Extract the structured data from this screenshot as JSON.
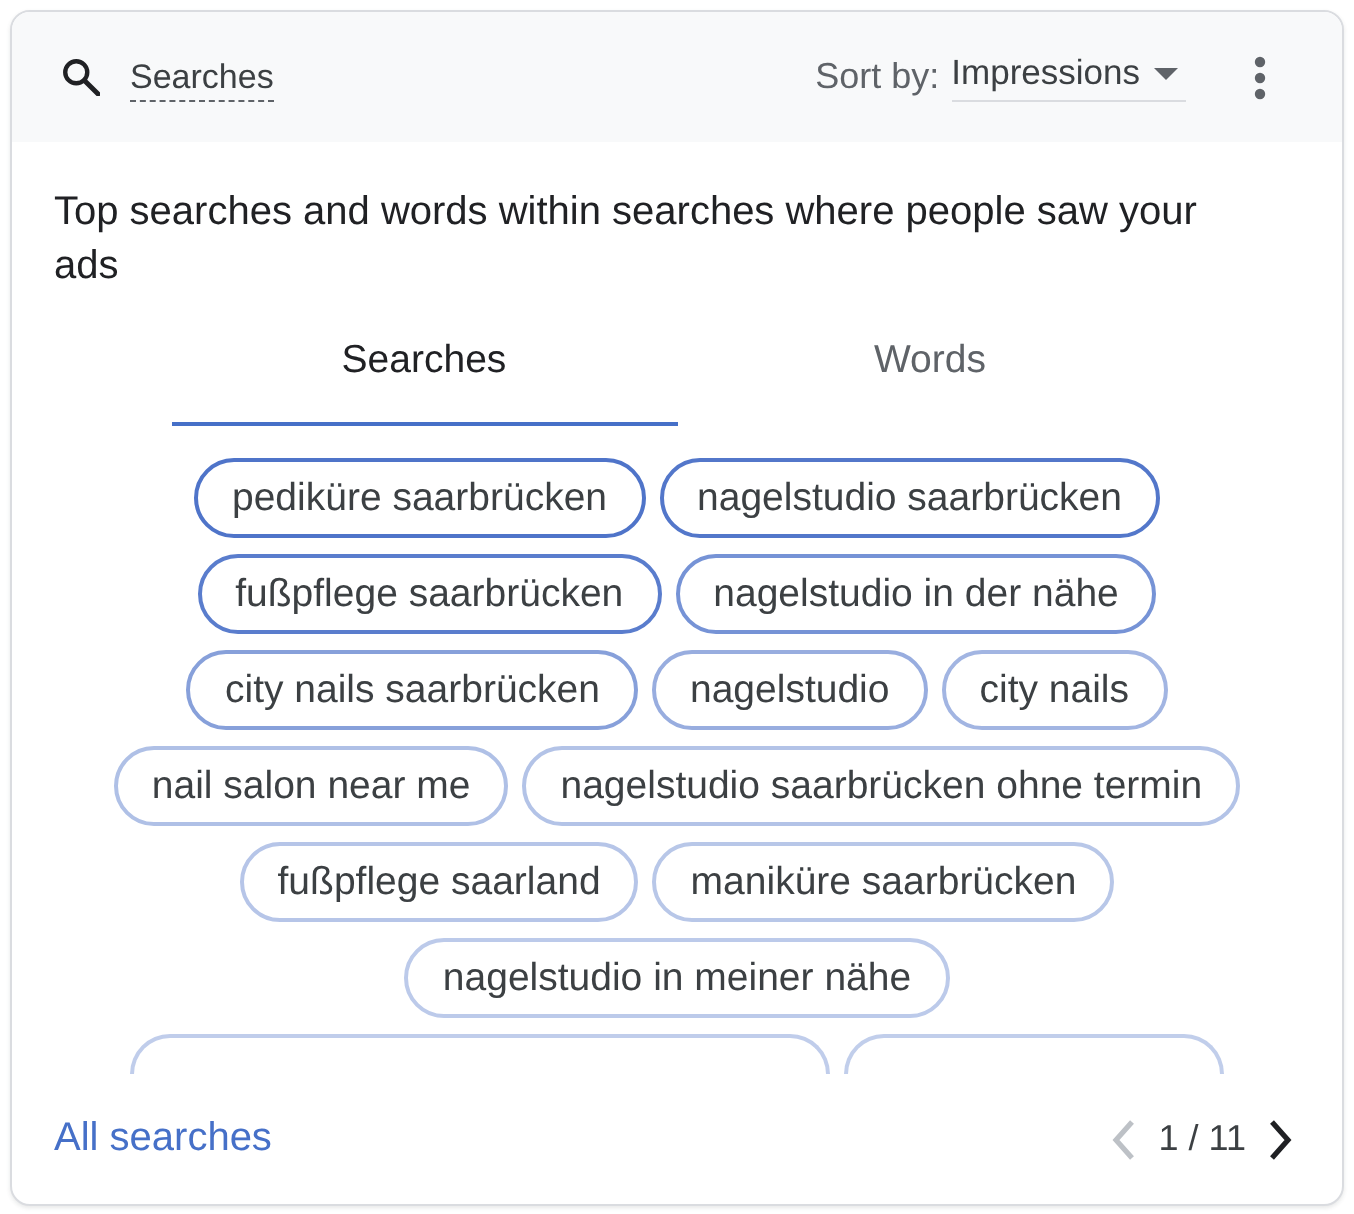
{
  "header": {
    "title": "Searches",
    "sort_label": "Sort by:",
    "sort_value": "Impressions"
  },
  "description": "Top searches and words within searches where people saw your ads",
  "tabs": [
    {
      "label": "Searches",
      "selected": true
    },
    {
      "label": "Words",
      "selected": false
    }
  ],
  "chip_rows": [
    [
      {
        "kind": "term",
        "label": "pediküre saarbrücken",
        "color": "#4f74c9"
      },
      {
        "kind": "term",
        "label": "nagelstudio saarbrücken",
        "color": "#5377ca"
      }
    ],
    [
      {
        "kind": "term",
        "label": "fußpflege saarbrücken",
        "color": "#5a7dcd"
      },
      {
        "kind": "term",
        "label": "nagelstudio in der nähe",
        "color": "#7693d6"
      }
    ],
    [
      {
        "kind": "term",
        "label": "city nails saarbrücken",
        "color": "#87a0da"
      },
      {
        "kind": "term",
        "label": "nagelstudio",
        "color": "#98addf"
      },
      {
        "kind": "term",
        "label": "city nails",
        "color": "#a2b5e2"
      }
    ],
    [
      {
        "kind": "term",
        "label": "nail salon near me",
        "color": "#afc0e6"
      },
      {
        "kind": "term",
        "label": "nagelstudio saarbrücken ohne termin",
        "color": "#b3c3e7"
      }
    ],
    [
      {
        "kind": "term",
        "label": "fußpflege saarland",
        "color": "#b6c5e8"
      },
      {
        "kind": "term",
        "label": "maniküre saarbrücken",
        "color": "#b8c7e8"
      }
    ],
    [
      {
        "kind": "term",
        "label": "nagelstudio in meiner nähe",
        "color": "#bccaea"
      }
    ],
    [
      {
        "kind": "cut",
        "color": "#c0cdeb"
      },
      {
        "kind": "cut",
        "color": "#c1ceeb"
      }
    ]
  ],
  "footer": {
    "link": "All searches",
    "page": "1 / 11",
    "prev_disabled": true,
    "next_disabled": false
  }
}
